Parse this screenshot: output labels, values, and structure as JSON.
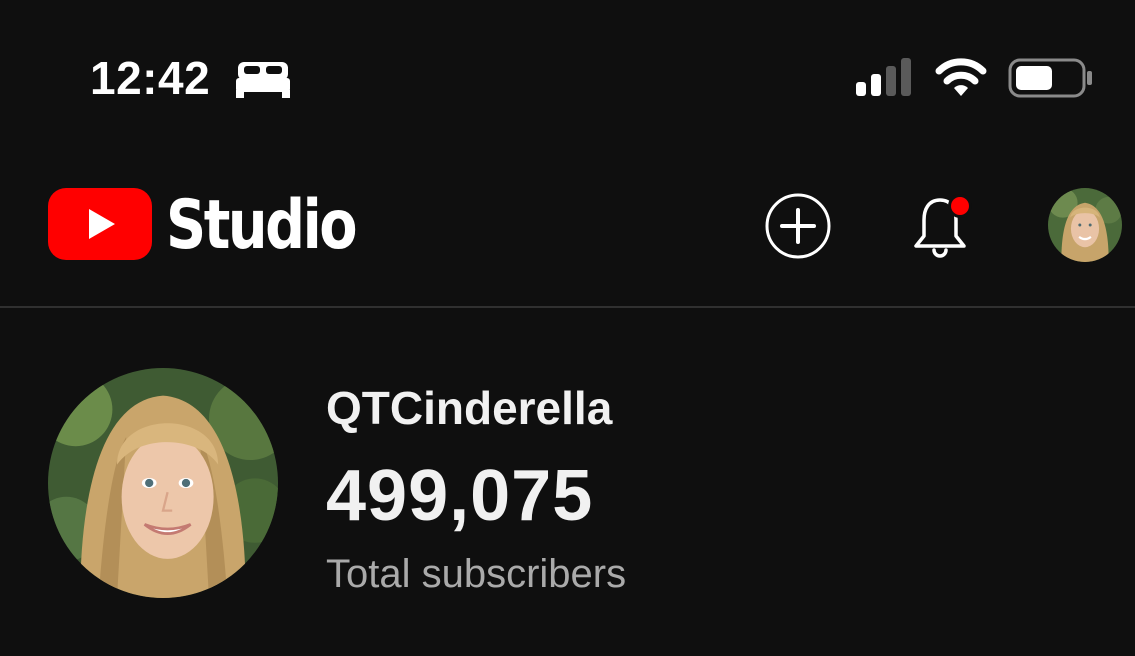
{
  "status_bar": {
    "time": "12:42",
    "icons": [
      "sleep-icon",
      "signal-icon",
      "wifi-icon",
      "battery-icon"
    ]
  },
  "header": {
    "logo_text": "Studio",
    "icons": [
      "youtube-logo-icon",
      "create-icon",
      "notifications-bell-icon",
      "account-avatar"
    ],
    "notification_badge_color": "#ff0000",
    "brand_color": "#ff0000"
  },
  "channel": {
    "name": "QTCinderella",
    "subscriber_count": "499,075",
    "subscriber_label": "Total subscribers"
  },
  "colors": {
    "background": "#0f0f0f",
    "text_primary": "#f1f1f1",
    "text_secondary": "#aaaaaa",
    "divider": "#303030"
  }
}
